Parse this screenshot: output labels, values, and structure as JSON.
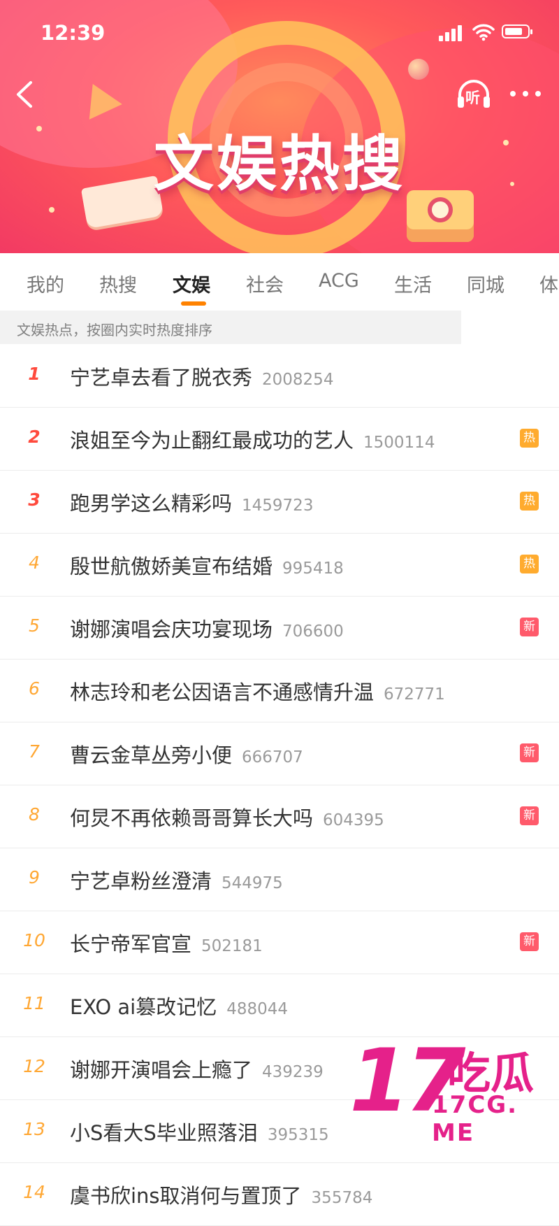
{
  "status_bar": {
    "time": "12:39"
  },
  "header": {
    "title": "文娱热搜",
    "listen_label": "听",
    "colors": {
      "banner": "#f23a63",
      "title_text": "#ffffff"
    }
  },
  "tabs": [
    {
      "label": "我的",
      "active": false
    },
    {
      "label": "热搜",
      "active": false
    },
    {
      "label": "文娱",
      "active": true
    },
    {
      "label": "社会",
      "active": false
    },
    {
      "label": "ACG",
      "active": false
    },
    {
      "label": "生活",
      "active": false
    },
    {
      "label": "同城",
      "active": false
    },
    {
      "label": "体",
      "active": false
    }
  ],
  "accent_color": "#ff8200",
  "subheader": "文娱热点，按圈内实时热度排序",
  "items": [
    {
      "rank": "1",
      "title": "宁艺卓去看了脱衣秀",
      "count": "2008254",
      "badge": ""
    },
    {
      "rank": "2",
      "title": "浪姐至今为止翻红最成功的艺人",
      "count": "1500114",
      "badge": "热"
    },
    {
      "rank": "3",
      "title": "跑男学这么精彩吗",
      "count": "1459723",
      "badge": "热"
    },
    {
      "rank": "4",
      "title": "殷世航傲娇美宣布结婚",
      "count": "995418",
      "badge": "热"
    },
    {
      "rank": "5",
      "title": "谢娜演唱会庆功宴现场",
      "count": "706600",
      "badge": "新"
    },
    {
      "rank": "6",
      "title": "林志玲和老公因语言不通感情升温",
      "count": "672771",
      "badge": ""
    },
    {
      "rank": "7",
      "title": "曹云金草丛旁小便",
      "count": "666707",
      "badge": "新"
    },
    {
      "rank": "8",
      "title": "何炅不再依赖哥哥算长大吗",
      "count": "604395",
      "badge": "新"
    },
    {
      "rank": "9",
      "title": "宁艺卓粉丝澄清",
      "count": "544975",
      "badge": ""
    },
    {
      "rank": "10",
      "title": "长宁帝军官宣",
      "count": "502181",
      "badge": "新"
    },
    {
      "rank": "11",
      "title": "EXO ai篡改记忆",
      "count": "488044",
      "badge": ""
    },
    {
      "rank": "12",
      "title": "谢娜开演唱会上瘾了",
      "count": "439239",
      "badge": ""
    },
    {
      "rank": "13",
      "title": "小S看大S毕业照落泪",
      "count": "395315",
      "badge": ""
    },
    {
      "rank": "14",
      "title": "虞书欣ins取消何与置顶了",
      "count": "355784",
      "badge": ""
    }
  ],
  "watermark": {
    "number": "17",
    "name": "吃瓜",
    "url": "17CG. ME",
    "color": "#e5218a"
  }
}
